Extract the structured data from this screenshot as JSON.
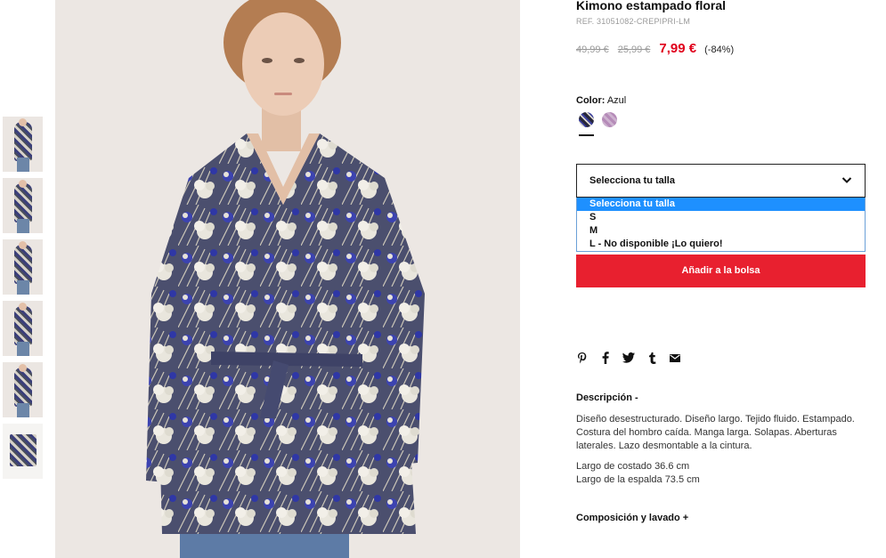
{
  "product": {
    "title": "Kimono estampado floral",
    "ref": "REF. 31051082-CREPIPRI-LM",
    "prices": {
      "original": "49,99 €",
      "previous": "25,99 €",
      "current": "7,99 €",
      "discount": "(-84%)"
    }
  },
  "color": {
    "label": "Color:",
    "value": "Azul",
    "swatches": [
      "blue-floral-swatch",
      "pink-floral-swatch"
    ],
    "colors": {
      "sale": "#e0001b",
      "button": "#e8202f",
      "selected_option": "#1e90ff"
    }
  },
  "size": {
    "selected": "Selecciona tu talla",
    "options": [
      "Selecciona tu talla",
      "S",
      "M",
      "L - No disponible ¡Lo quiero!"
    ]
  },
  "actions": {
    "add_to_bag": "Añadir a la bolsa"
  },
  "share_icons": [
    "pinterest-icon",
    "facebook-icon",
    "twitter-icon",
    "tumblr-icon",
    "email-icon"
  ],
  "description": {
    "title": "Descripción  -",
    "body": "Diseño desestructurado. Diseño largo. Tejido fluido. Estampado. Costura del hombro caída. Manga larga. Solapas. Aberturas laterales. Lazo desmontable a la cintura.",
    "measure_side": "Largo de costado 36.6 cm",
    "measure_back": "Largo de la espalda 73.5 cm"
  },
  "composition": {
    "title": "Composición y lavado  +"
  }
}
